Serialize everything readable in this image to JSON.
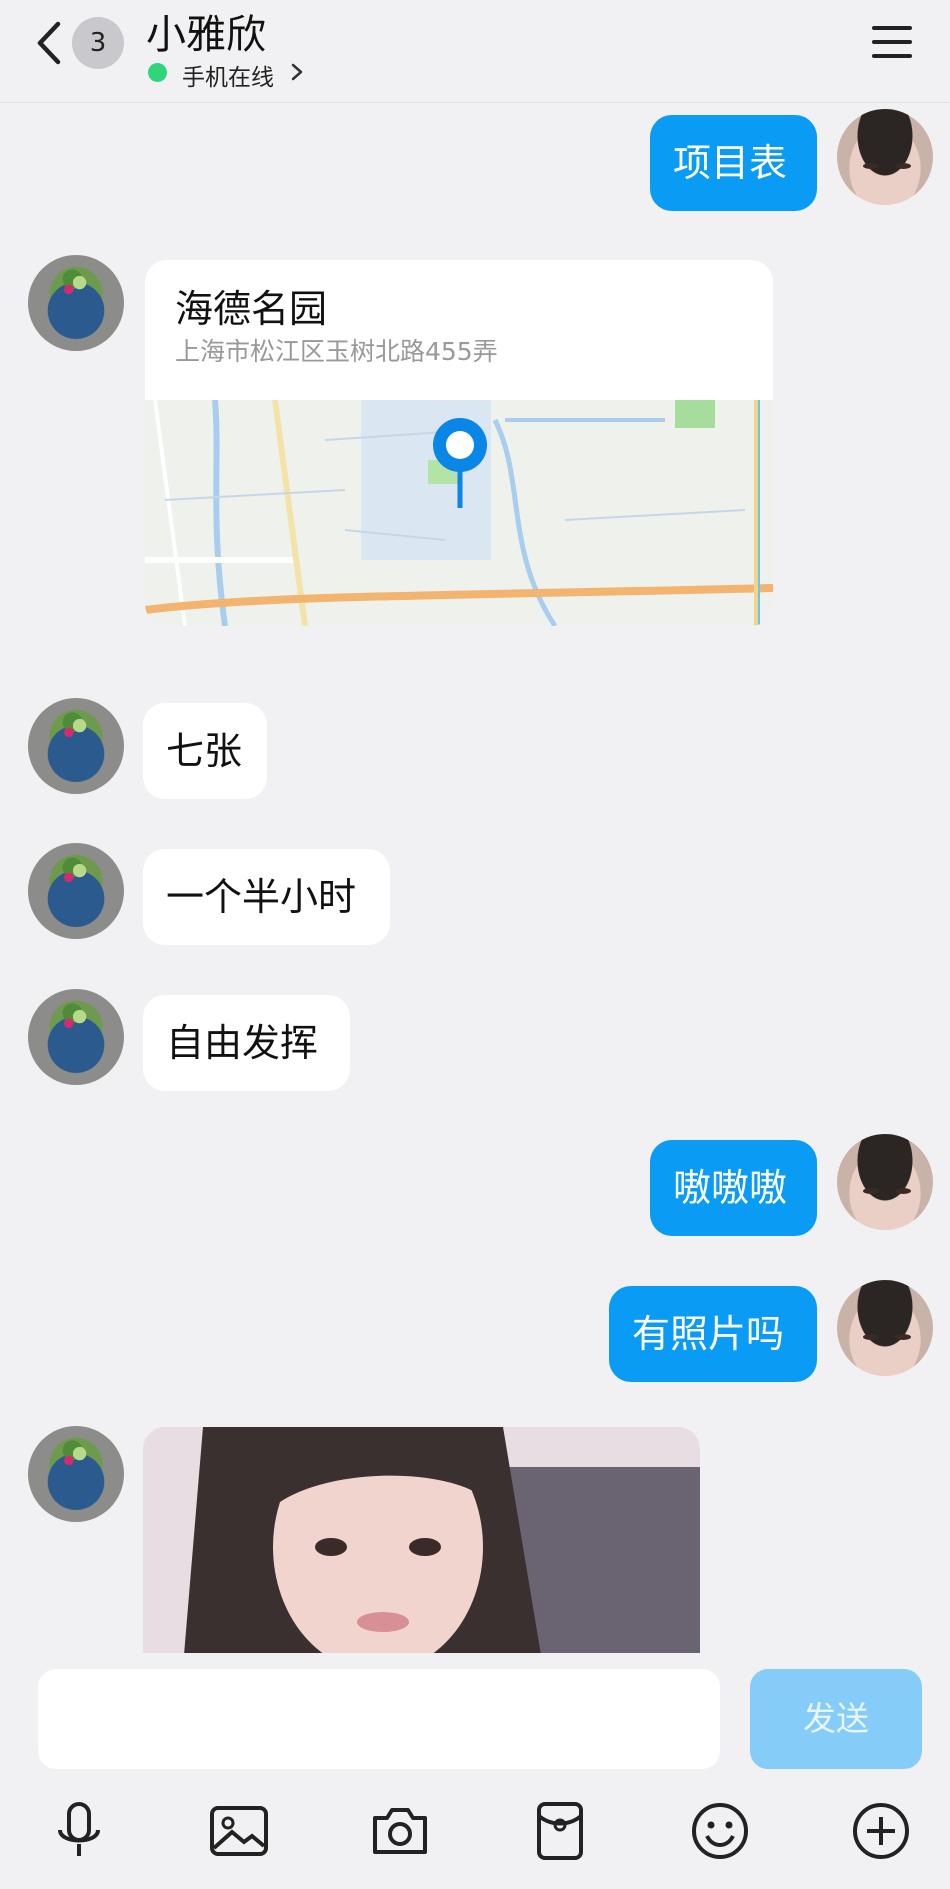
{
  "header": {
    "unread_count": "3",
    "title": "小雅欣",
    "status": "手机在线"
  },
  "messages": [
    {
      "side": "out",
      "type": "text",
      "text": "项目表"
    },
    {
      "side": "in",
      "type": "location",
      "name": "海德名园",
      "address": "上海市松江区玉树北路455弄"
    },
    {
      "side": "in",
      "type": "text",
      "text": "七张"
    },
    {
      "side": "in",
      "type": "text",
      "text": "一个半小时"
    },
    {
      "side": "in",
      "type": "text",
      "text": "自由发挥"
    },
    {
      "side": "out",
      "type": "text",
      "text": "嗷嗷嗷"
    },
    {
      "side": "out",
      "type": "text",
      "text": "有照片吗"
    },
    {
      "side": "in",
      "type": "image"
    }
  ],
  "input": {
    "placeholder": "",
    "value": "",
    "send_label": "发送"
  },
  "toolbar": [
    "microphone-icon",
    "image-icon",
    "camera-icon",
    "red-packet-icon",
    "emoji-icon",
    "plus-icon"
  ],
  "colors": {
    "accent": "#0a9bf5",
    "send_disabled": "#85cdf8",
    "online": "#2fd57a",
    "background": "#f1f1f3"
  }
}
